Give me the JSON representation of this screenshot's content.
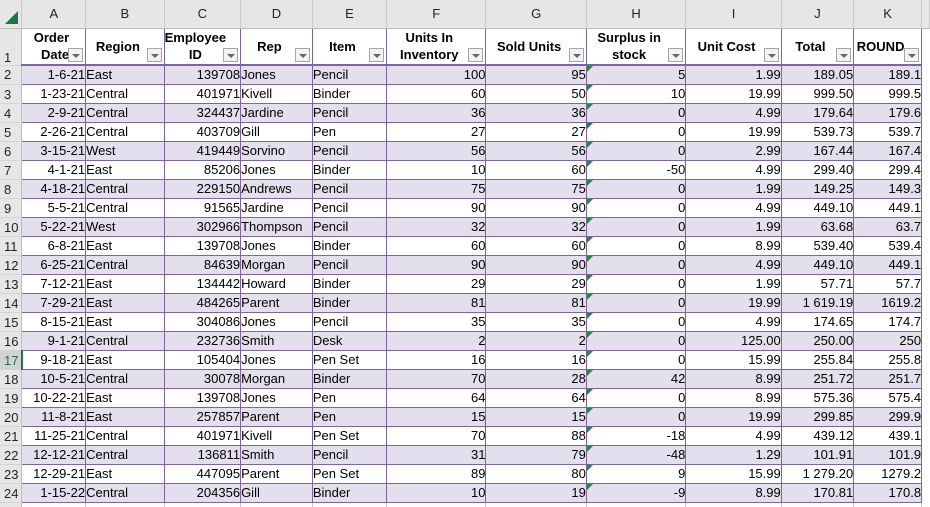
{
  "spreadsheet": {
    "column_letters": [
      "A",
      "B",
      "C",
      "D",
      "E",
      "F",
      "G",
      "H",
      "I",
      "J",
      "K"
    ],
    "active_row": 17,
    "colors": {
      "accent_green": "#217346",
      "table_border": "#8064a2",
      "band_fill": "#e4dfec",
      "error_indicator": "#1e8a3a"
    },
    "headers": [
      {
        "col": "A",
        "label": "Order Date",
        "line1": "Order",
        "line2": "Date"
      },
      {
        "col": "B",
        "label": "Region",
        "line1": "Region",
        "line2": ""
      },
      {
        "col": "C",
        "label": "Employee ID",
        "line1": "Employee",
        "line2": "ID"
      },
      {
        "col": "D",
        "label": "Rep",
        "line1": "Rep",
        "line2": ""
      },
      {
        "col": "E",
        "label": "Item",
        "line1": "Item",
        "line2": ""
      },
      {
        "col": "F",
        "label": "Units In Inventory",
        "line1": "Units In",
        "line2": "Inventory"
      },
      {
        "col": "G",
        "label": "Sold Units",
        "line1": "Sold Units",
        "line2": ""
      },
      {
        "col": "H",
        "label": "Surplus in stock",
        "line1": "Surplus in",
        "line2": "stock"
      },
      {
        "col": "I",
        "label": "Unit Cost",
        "line1": "Unit Cost",
        "line2": ""
      },
      {
        "col": "J",
        "label": "Total",
        "line1": "Total",
        "line2": ""
      },
      {
        "col": "K",
        "label": "ROUND",
        "line1": "ROUND",
        "line2": ""
      }
    ],
    "header_row_number": "1",
    "rows": [
      {
        "n": "2",
        "date": "1-6-21",
        "region": "East",
        "emp": "139708",
        "rep": "Jones",
        "item": "Pencil",
        "inv": "100",
        "sold": "95",
        "surplus": "5",
        "cost": "1.99",
        "total": "189.05",
        "round": "189.1"
      },
      {
        "n": "3",
        "date": "1-23-21",
        "region": "Central",
        "emp": "401971",
        "rep": "Kivell",
        "item": "Binder",
        "inv": "60",
        "sold": "50",
        "surplus": "10",
        "cost": "19.99",
        "total": "999.50",
        "round": "999.5"
      },
      {
        "n": "4",
        "date": "2-9-21",
        "region": "Central",
        "emp": "324437",
        "rep": "Jardine",
        "item": "Pencil",
        "inv": "36",
        "sold": "36",
        "surplus": "0",
        "cost": "4.99",
        "total": "179.64",
        "round": "179.6"
      },
      {
        "n": "5",
        "date": "2-26-21",
        "region": "Central",
        "emp": "403709",
        "rep": "Gill",
        "item": "Pen",
        "inv": "27",
        "sold": "27",
        "surplus": "0",
        "cost": "19.99",
        "total": "539.73",
        "round": "539.7"
      },
      {
        "n": "6",
        "date": "3-15-21",
        "region": "West",
        "emp": "419449",
        "rep": "Sorvino",
        "item": "Pencil",
        "inv": "56",
        "sold": "56",
        "surplus": "0",
        "cost": "2.99",
        "total": "167.44",
        "round": "167.4"
      },
      {
        "n": "7",
        "date": "4-1-21",
        "region": "East",
        "emp": "85206",
        "rep": "Jones",
        "item": "Binder",
        "inv": "10",
        "sold": "60",
        "surplus": "-50",
        "cost": "4.99",
        "total": "299.40",
        "round": "299.4"
      },
      {
        "n": "8",
        "date": "4-18-21",
        "region": "Central",
        "emp": "229150",
        "rep": "Andrews",
        "item": "Pencil",
        "inv": "75",
        "sold": "75",
        "surplus": "0",
        "cost": "1.99",
        "total": "149.25",
        "round": "149.3"
      },
      {
        "n": "9",
        "date": "5-5-21",
        "region": "Central",
        "emp": "91565",
        "rep": "Jardine",
        "item": "Pencil",
        "inv": "90",
        "sold": "90",
        "surplus": "0",
        "cost": "4.99",
        "total": "449.10",
        "round": "449.1"
      },
      {
        "n": "10",
        "date": "5-22-21",
        "region": "West",
        "emp": "302966",
        "rep": "Thompson",
        "item": "Pencil",
        "inv": "32",
        "sold": "32",
        "surplus": "0",
        "cost": "1.99",
        "total": "63.68",
        "round": "63.7"
      },
      {
        "n": "11",
        "date": "6-8-21",
        "region": "East",
        "emp": "139708",
        "rep": "Jones",
        "item": "Binder",
        "inv": "60",
        "sold": "60",
        "surplus": "0",
        "cost": "8.99",
        "total": "539.40",
        "round": "539.4"
      },
      {
        "n": "12",
        "date": "6-25-21",
        "region": "Central",
        "emp": "84639",
        "rep": "Morgan",
        "item": "Pencil",
        "inv": "90",
        "sold": "90",
        "surplus": "0",
        "cost": "4.99",
        "total": "449.10",
        "round": "449.1"
      },
      {
        "n": "13",
        "date": "7-12-21",
        "region": "East",
        "emp": "134442",
        "rep": "Howard",
        "item": "Binder",
        "inv": "29",
        "sold": "29",
        "surplus": "0",
        "cost": "1.99",
        "total": "57.71",
        "round": "57.7"
      },
      {
        "n": "14",
        "date": "7-29-21",
        "region": "East",
        "emp": "484265",
        "rep": "Parent",
        "item": "Binder",
        "inv": "81",
        "sold": "81",
        "surplus": "0",
        "cost": "19.99",
        "total": "1 619.19",
        "round": "1619.2"
      },
      {
        "n": "15",
        "date": "8-15-21",
        "region": "East",
        "emp": "304086",
        "rep": "Jones",
        "item": "Pencil",
        "inv": "35",
        "sold": "35",
        "surplus": "0",
        "cost": "4.99",
        "total": "174.65",
        "round": "174.7"
      },
      {
        "n": "16",
        "date": "9-1-21",
        "region": "Central",
        "emp": "232736",
        "rep": "Smith",
        "item": "Desk",
        "inv": "2",
        "sold": "2",
        "surplus": "0",
        "cost": "125.00",
        "total": "250.00",
        "round": "250"
      },
      {
        "n": "17",
        "date": "9-18-21",
        "region": "East",
        "emp": "105404",
        "rep": "Jones",
        "item": "Pen Set",
        "inv": "16",
        "sold": "16",
        "surplus": "0",
        "cost": "15.99",
        "total": "255.84",
        "round": "255.8"
      },
      {
        "n": "18",
        "date": "10-5-21",
        "region": "Central",
        "emp": "30078",
        "rep": "Morgan",
        "item": "Binder",
        "inv": "70",
        "sold": "28",
        "surplus": "42",
        "cost": "8.99",
        "total": "251.72",
        "round": "251.7"
      },
      {
        "n": "19",
        "date": "10-22-21",
        "region": "East",
        "emp": "139708",
        "rep": "Jones",
        "item": "Pen",
        "inv": "64",
        "sold": "64",
        "surplus": "0",
        "cost": "8.99",
        "total": "575.36",
        "round": "575.4"
      },
      {
        "n": "20",
        "date": "11-8-21",
        "region": "East",
        "emp": "257857",
        "rep": "Parent",
        "item": "Pen",
        "inv": "15",
        "sold": "15",
        "surplus": "0",
        "cost": "19.99",
        "total": "299.85",
        "round": "299.9"
      },
      {
        "n": "21",
        "date": "11-25-21",
        "region": "Central",
        "emp": "401971",
        "rep": "Kivell",
        "item": "Pen Set",
        "inv": "70",
        "sold": "88",
        "surplus": "-18",
        "cost": "4.99",
        "total": "439.12",
        "round": "439.1"
      },
      {
        "n": "22",
        "date": "12-12-21",
        "region": "Central",
        "emp": "136811",
        "rep": "Smith",
        "item": "Pencil",
        "inv": "31",
        "sold": "79",
        "surplus": "-48",
        "cost": "1.29",
        "total": "101.91",
        "round": "101.9"
      },
      {
        "n": "23",
        "date": "12-29-21",
        "region": "East",
        "emp": "447095",
        "rep": "Parent",
        "item": "Pen Set",
        "inv": "89",
        "sold": "80",
        "surplus": "9",
        "cost": "15.99",
        "total": "1 279.20",
        "round": "1279.2"
      },
      {
        "n": "24",
        "date": "1-15-22",
        "region": "Central",
        "emp": "204356",
        "rep": "Gill",
        "item": "Binder",
        "inv": "10",
        "sold": "19",
        "surplus": "-9",
        "cost": "8.99",
        "total": "170.81",
        "round": "170.8"
      }
    ]
  }
}
